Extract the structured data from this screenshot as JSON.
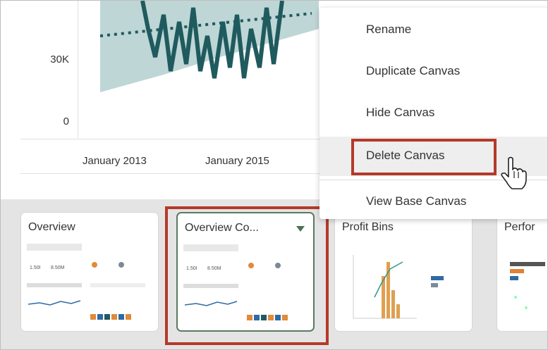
{
  "chart": {
    "y_ticks": [
      "30K",
      "0"
    ],
    "x_ticks": [
      "January 2013",
      "January 2015"
    ]
  },
  "context_menu": {
    "items": [
      {
        "label": "Rename"
      },
      {
        "label": "Duplicate Canvas"
      },
      {
        "label": "Hide Canvas"
      },
      {
        "label": "Delete Canvas"
      },
      {
        "label": "View Base Canvas"
      }
    ],
    "highlighted_item": "Delete Canvas"
  },
  "canvases": [
    {
      "title": "Overview"
    },
    {
      "title": "Overview Co..."
    },
    {
      "title": "Profit Bins"
    },
    {
      "title": "Perfor"
    }
  ],
  "thumbnail_text": {
    "kpi_1": "1.50I",
    "kpi_2": "8.50M"
  },
  "colors": {
    "line": "#1f5a5e",
    "band": "#bfd6d6",
    "highlight": "#b43a2a",
    "active_border": "#5b7a60"
  }
}
